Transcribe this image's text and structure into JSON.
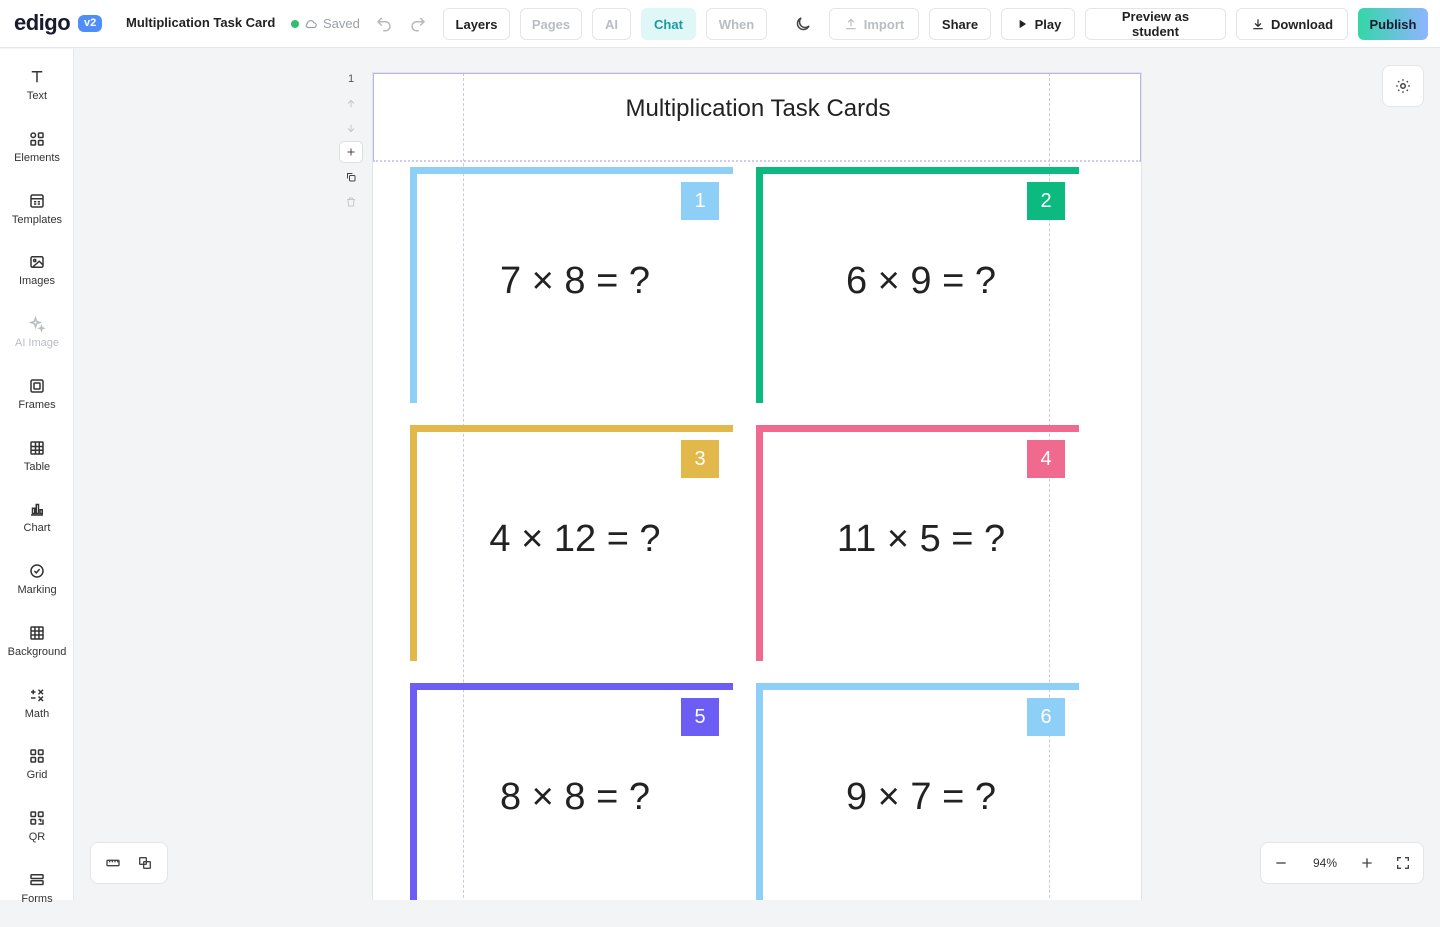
{
  "app": {
    "logo": "edigo",
    "version": "v2",
    "doc_title": "Multiplication Task Cards",
    "status": "Saved"
  },
  "toolbar": {
    "layers": "Layers",
    "pages": "Pages",
    "ai": "AI",
    "chat": "Chat",
    "when": "When",
    "import": "Import",
    "share": "Share",
    "play": "Play",
    "preview": "Preview as student",
    "download": "Download",
    "publish": "Publish"
  },
  "sidebar": {
    "items": [
      {
        "label": "Text",
        "icon": "text-icon"
      },
      {
        "label": "Elements",
        "icon": "elements-icon"
      },
      {
        "label": "Templates",
        "icon": "templates-icon"
      },
      {
        "label": "Images",
        "icon": "image-icon"
      },
      {
        "label": "AI Image",
        "icon": "sparkle-icon"
      },
      {
        "label": "Frames",
        "icon": "frame-icon"
      },
      {
        "label": "Table",
        "icon": "table-icon"
      },
      {
        "label": "Chart",
        "icon": "chart-icon"
      },
      {
        "label": "Marking",
        "icon": "check-circle-icon"
      },
      {
        "label": "Background",
        "icon": "background-icon"
      },
      {
        "label": "Math",
        "icon": "math-icon"
      },
      {
        "label": "Grid",
        "icon": "grid-icon"
      },
      {
        "label": "QR",
        "icon": "qr-icon"
      },
      {
        "label": "Forms",
        "icon": "forms-icon"
      }
    ]
  },
  "canvas": {
    "page_number": "1",
    "title": "Multiplication Task Cards",
    "zoom": "94%",
    "cards": [
      {
        "number": "1",
        "question": "7 × 8 = ?",
        "color": "#8dcff7"
      },
      {
        "number": "2",
        "question": "6 × 9 = ?",
        "color": "#0cb97f"
      },
      {
        "number": "3",
        "question": "4 × 12 = ?",
        "color": "#e3b84a"
      },
      {
        "number": "4",
        "question": "11 × 5 = ?",
        "color": "#ef6a8e"
      },
      {
        "number": "5",
        "question": "8 × 8 = ?",
        "color": "#6c5ef5"
      },
      {
        "number": "6",
        "question": "9 × 7 = ?",
        "color": "#8dcff7"
      }
    ]
  }
}
